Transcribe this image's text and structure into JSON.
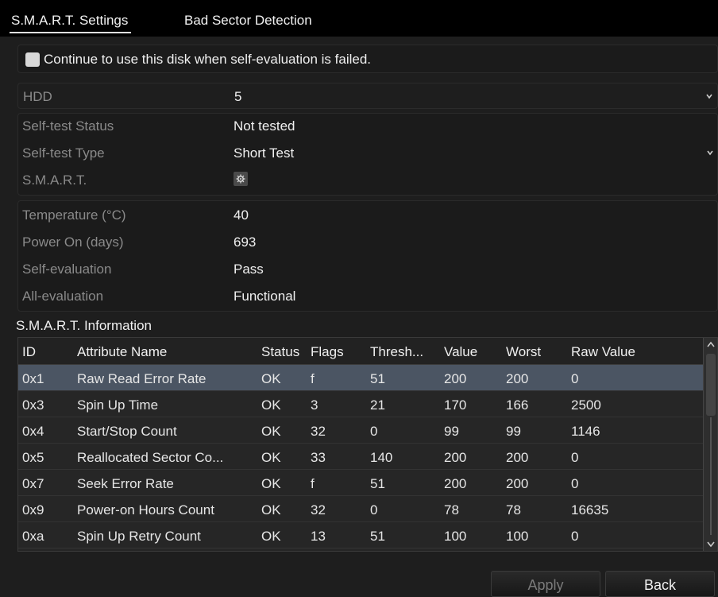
{
  "tabs": [
    {
      "label": "S.M.A.R.T. Settings",
      "active": true
    },
    {
      "label": "Bad Sector Detection",
      "active": false
    }
  ],
  "checkbox": {
    "label": "Continue to use this disk when self-evaluation is failed.",
    "checked": false
  },
  "hdd": {
    "label": "HDD",
    "value": "5"
  },
  "self_test_status": {
    "label": "Self-test Status",
    "value": "Not tested"
  },
  "self_test_type": {
    "label": "Self-test Type",
    "value": "Short Test"
  },
  "smart": {
    "label": "S.M.A.R.T.",
    "icon": "gear-icon"
  },
  "temperature": {
    "label": "Temperature (°C)",
    "value": "40"
  },
  "power_on": {
    "label": "Power On (days)",
    "value": "693"
  },
  "self_evaluation": {
    "label": "Self-evaluation",
    "value": "Pass"
  },
  "all_evaluation": {
    "label": "All-evaluation",
    "value": "Functional"
  },
  "info_title": "S.M.A.R.T. Information",
  "table": {
    "headers": [
      "ID",
      "Attribute Name",
      "Status",
      "Flags",
      "Thresh...",
      "Value",
      "Worst",
      "Raw Value"
    ],
    "rows": [
      [
        "0x1",
        "Raw Read Error Rate",
        "OK",
        "f",
        "51",
        "200",
        "200",
        "0"
      ],
      [
        "0x3",
        "Spin Up Time",
        "OK",
        "3",
        "21",
        "170",
        "166",
        "2500"
      ],
      [
        "0x4",
        "Start/Stop Count",
        "OK",
        "32",
        "0",
        "99",
        "99",
        "1146"
      ],
      [
        "0x5",
        "Reallocated Sector Co...",
        "OK",
        "33",
        "140",
        "200",
        "200",
        "0"
      ],
      [
        "0x7",
        "Seek Error Rate",
        "OK",
        "f",
        "51",
        "200",
        "200",
        "0"
      ],
      [
        "0x9",
        "Power-on Hours Count",
        "OK",
        "32",
        "0",
        "78",
        "78",
        "16635"
      ],
      [
        "0xa",
        "Spin Up Retry Count",
        "OK",
        "13",
        "51",
        "100",
        "100",
        "0"
      ]
    ],
    "selected_row": 0
  },
  "buttons": {
    "apply": "Apply",
    "back": "Back"
  },
  "colors": {
    "background": "#000000",
    "panel": "#1e1e1e",
    "selected_row": "#4b5563"
  }
}
